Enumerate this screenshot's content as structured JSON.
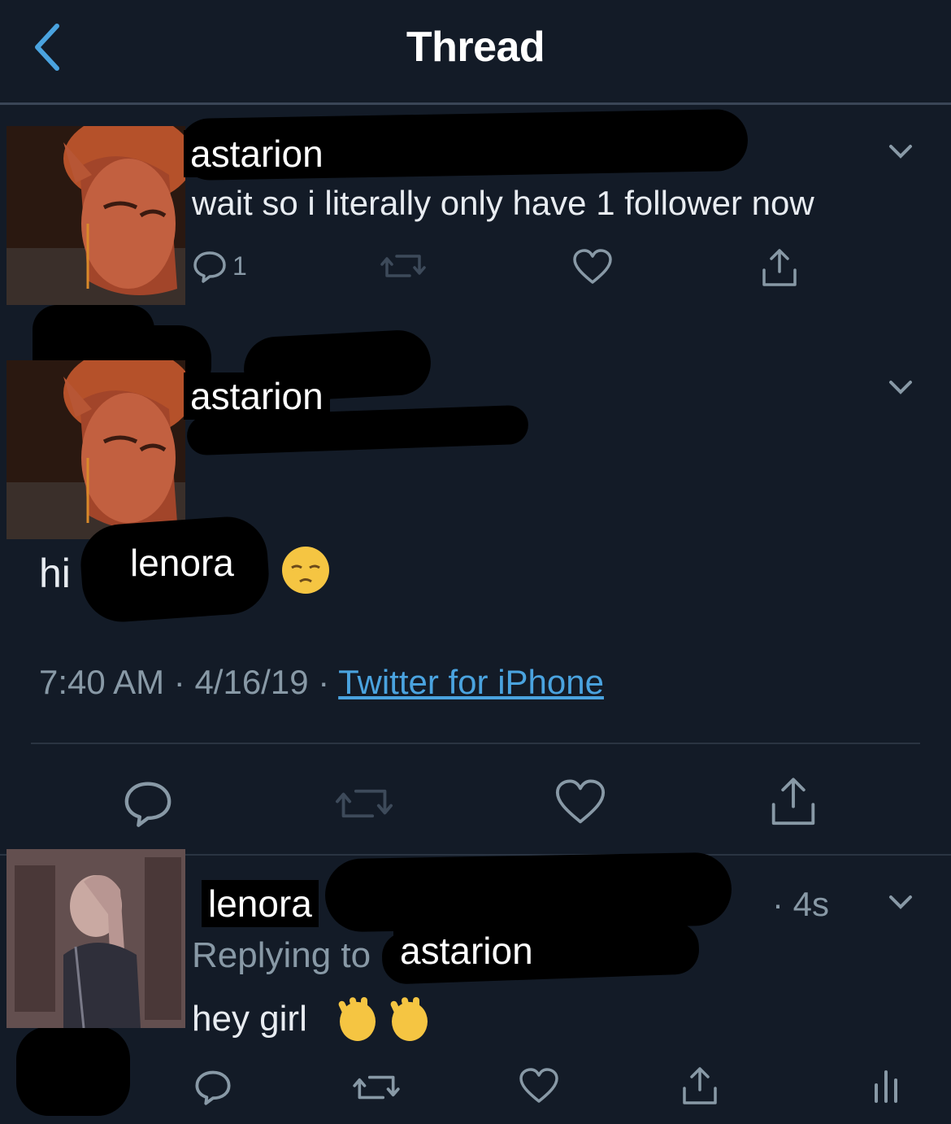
{
  "header": {
    "title": "Thread"
  },
  "tweet1": {
    "name": "astarion",
    "text": "wait so i literally only have 1 follower now",
    "reply_count": "1"
  },
  "tweet2": {
    "name": "astarion",
    "body_prefix": "hi",
    "body_mention": "lenora",
    "emoji": "😔",
    "time": "7:40 AM",
    "sep1": " · ",
    "date": "4/16/19",
    "sep2": " · ",
    "client": "Twitter for iPhone"
  },
  "reply": {
    "name": "lenora",
    "time": "· 4s",
    "replying_to_label": "Replying to",
    "replying_to_user": "astarion",
    "text": "hey girl",
    "emoji": "👋👋"
  },
  "colors": {
    "background": "#131b27",
    "link": "#4aa3df",
    "muted": "#8899a6",
    "emoji_face": "#f5c542"
  },
  "icons": [
    "back-chevron-icon",
    "reply-icon",
    "retweet-icon",
    "like-icon",
    "share-icon",
    "chevron-down-icon",
    "analytics-icon"
  ]
}
